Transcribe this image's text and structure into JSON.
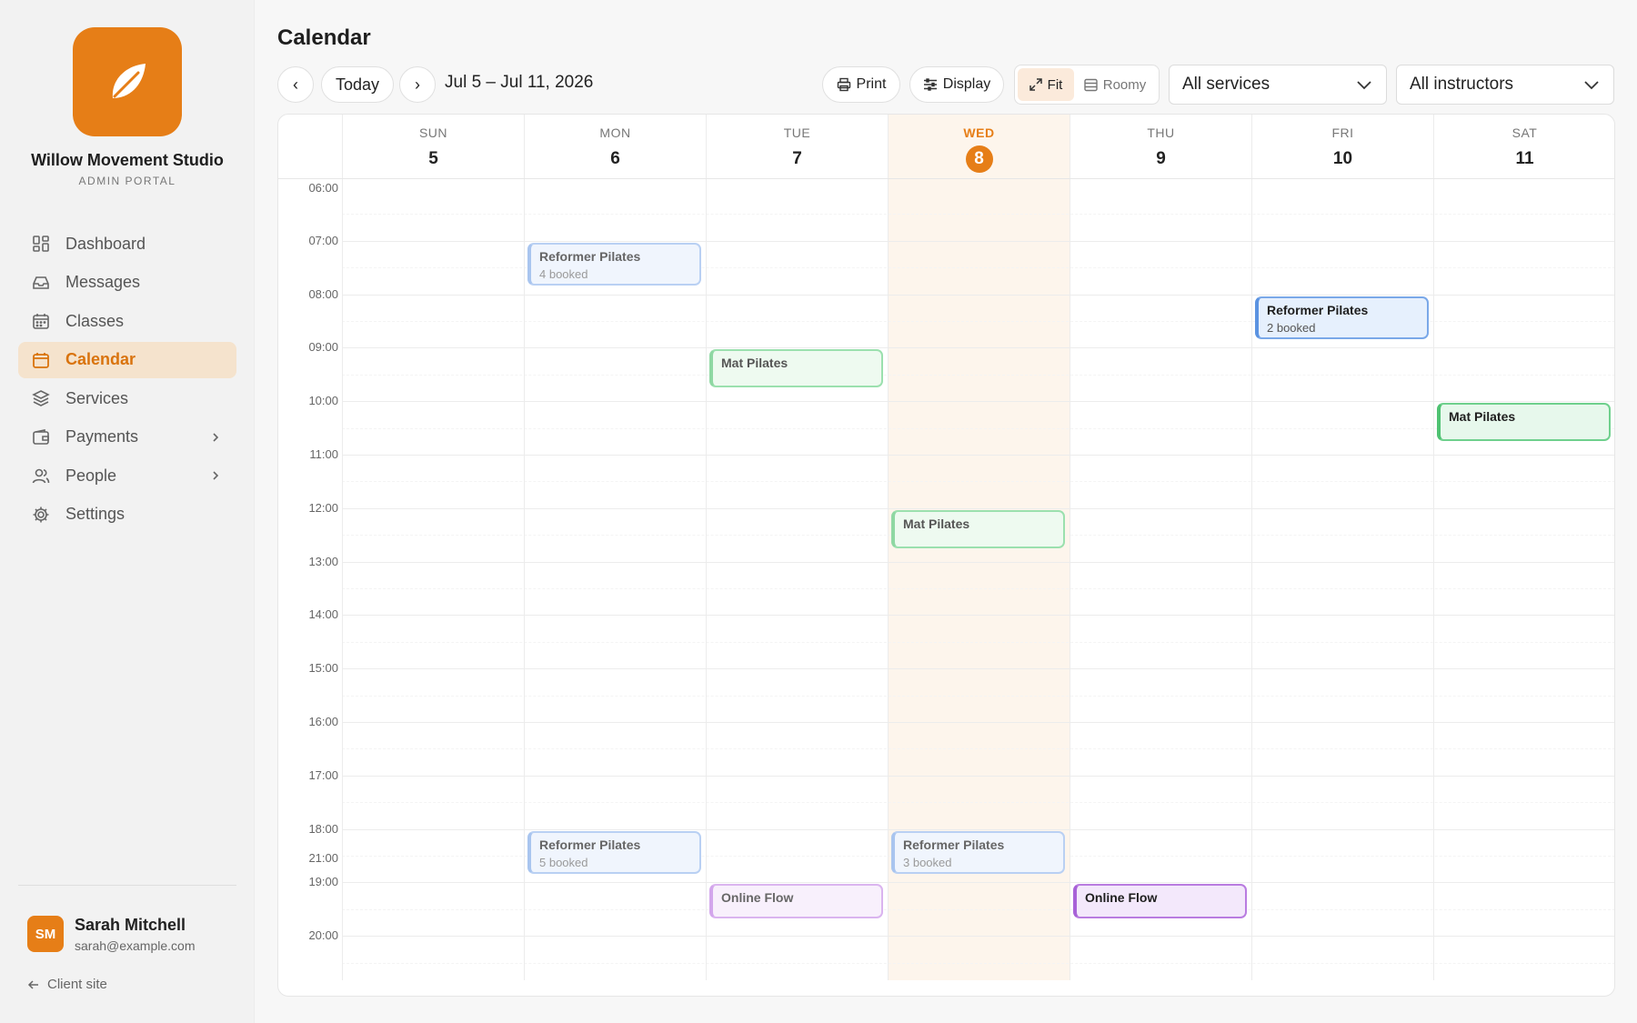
{
  "brand": {
    "name": "Willow Movement Studio",
    "subtitle": "ADMIN PORTAL",
    "accent": "#e67e17"
  },
  "sidebar": {
    "items": [
      {
        "label": "Dashboard",
        "icon": "dashboard-icon"
      },
      {
        "label": "Messages",
        "icon": "inbox-icon"
      },
      {
        "label": "Classes",
        "icon": "calendar-grid-icon"
      },
      {
        "label": "Calendar",
        "icon": "calendar-icon",
        "active": true
      },
      {
        "label": "Services",
        "icon": "layers-icon"
      },
      {
        "label": "Payments",
        "icon": "wallet-icon",
        "expandable": true
      },
      {
        "label": "People",
        "icon": "users-icon",
        "expandable": true
      },
      {
        "label": "Settings",
        "icon": "gear-icon"
      }
    ]
  },
  "user": {
    "initials": "SM",
    "name": "Sarah Mitchell",
    "email": "sarah@example.com"
  },
  "footer": {
    "client_site": "Client site"
  },
  "header": {
    "title": "Calendar",
    "prev": "‹",
    "today": "Today",
    "next": "›",
    "date_range": "Jul 5 – Jul 11, 2026",
    "print": "Print",
    "display": "Display",
    "fit": "Fit",
    "roomy": "Roomy",
    "services_select": "All services",
    "instructors_select": "All instructors"
  },
  "calendar": {
    "days": [
      {
        "name": "SUN",
        "num": "5"
      },
      {
        "name": "MON",
        "num": "6"
      },
      {
        "name": "TUE",
        "num": "7"
      },
      {
        "name": "WED",
        "num": "8",
        "today": true
      },
      {
        "name": "THU",
        "num": "9"
      },
      {
        "name": "FRI",
        "num": "10"
      },
      {
        "name": "SAT",
        "num": "11"
      }
    ],
    "hours": [
      "06:00",
      "07:00",
      "08:00",
      "09:00",
      "10:00",
      "11:00",
      "12:00",
      "13:00",
      "14:00",
      "15:00",
      "16:00",
      "17:00",
      "18:00",
      "19:00",
      "20:00",
      "21:00"
    ],
    "events": [
      {
        "title": "Reformer Pilates",
        "sub": "4 booked",
        "day": 1,
        "start": "07:00",
        "end": "07:50",
        "color": "blue",
        "past": true
      },
      {
        "title": "Reformer Pilates",
        "sub": "2 booked",
        "day": 5,
        "start": "08:00",
        "end": "08:50",
        "color": "blue",
        "past": false
      },
      {
        "title": "Mat Pilates",
        "sub": "",
        "day": 2,
        "start": "09:00",
        "end": "09:45",
        "color": "green",
        "past": true
      },
      {
        "title": "Mat Pilates",
        "sub": "",
        "day": 6,
        "start": "10:00",
        "end": "10:45",
        "color": "green",
        "past": false
      },
      {
        "title": "Mat Pilates",
        "sub": "",
        "day": 3,
        "start": "12:00",
        "end": "12:45",
        "color": "green",
        "past": true
      },
      {
        "title": "Reformer Pilates",
        "sub": "5 booked",
        "day": 1,
        "start": "18:00",
        "end": "18:50",
        "color": "blue",
        "past": true
      },
      {
        "title": "Reformer Pilates",
        "sub": "3 booked",
        "day": 3,
        "start": "18:00",
        "end": "18:50",
        "color": "blue",
        "past": true
      },
      {
        "title": "Online Flow",
        "sub": "",
        "day": 2,
        "start": "19:00",
        "end": "19:40",
        "color": "purple",
        "past": true
      },
      {
        "title": "Online Flow",
        "sub": "",
        "day": 4,
        "start": "19:00",
        "end": "19:40",
        "color": "purple",
        "past": false
      }
    ]
  }
}
